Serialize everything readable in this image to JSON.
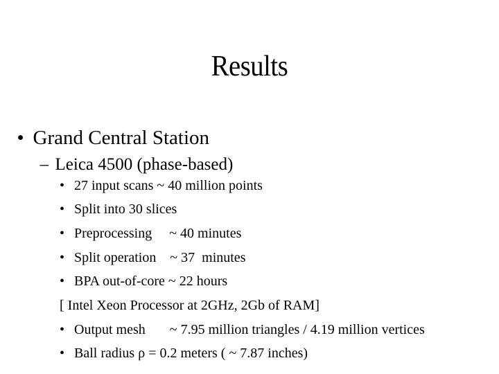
{
  "slide": {
    "title": "Results",
    "level1": {
      "bullet": "•",
      "text": "Grand Central Station"
    },
    "level2": {
      "bullet": "–",
      "text": "Leica 4500 (phase-based)"
    },
    "items": [
      {
        "bullet": "•",
        "text": "27 input scans ~ 40 million points"
      },
      {
        "bullet": "•",
        "text": "Split into 30 slices"
      },
      {
        "bullet": "•",
        "text": "Preprocessing     ~ 40 minutes"
      },
      {
        "bullet": "•",
        "text": "Split operation    ~ 37  minutes"
      },
      {
        "bullet": "•",
        "text": "BPA out-of-core ~ 22 hours"
      },
      {
        "bullet": "",
        "text": "[ Intel Xeon Processor at 2GHz, 2Gb of RAM]"
      },
      {
        "bullet": "•",
        "text": "Output mesh       ~ 7.95 million triangles / 4.19 million vertices"
      },
      {
        "bullet": "•",
        "text": "Ball radius ρ = 0.2 meters ( ~ 7.87 inches)"
      }
    ]
  }
}
